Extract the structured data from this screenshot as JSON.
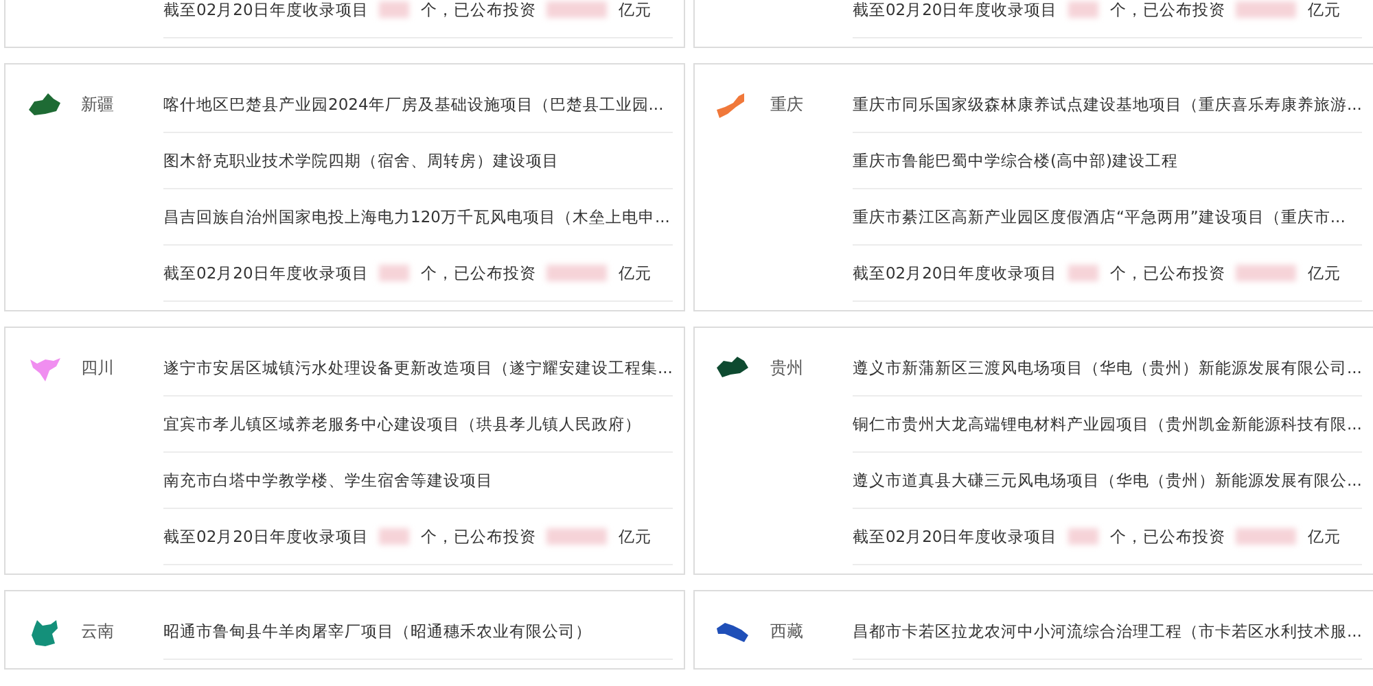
{
  "top_cards": [
    {
      "summary": {
        "prefix": "截至02月20日年度收录项目",
        "middle": "个，已公布投资",
        "suffix": "亿元"
      }
    },
    {
      "summary": {
        "prefix": "截至02月20日年度收录项目",
        "middle": "个，已公布投资",
        "suffix": "亿元"
      }
    }
  ],
  "regions": [
    {
      "name": "新疆",
      "color": "#1e6b34",
      "projects": [
        "喀什地区巴楚县产业园2024年厂房及基础设施项目（巴楚县工业园...",
        "图木舒克职业技术学院四期（宿舍、周转房）建设项目",
        "昌吉回族自治州国家电投上海电力120万千瓦风电项目（木垒上电申..."
      ],
      "summary": {
        "prefix": "截至02月20日年度收录项目",
        "middle": "个，已公布投资",
        "suffix": "亿元"
      }
    },
    {
      "name": "重庆",
      "color": "#f0783a",
      "projects": [
        "重庆市同乐国家级森林康养试点建设基地项目（重庆喜乐寿康养旅游...",
        "重庆市鲁能巴蜀中学综合楼(高中部)建设工程",
        "重庆市綦江区高新产业园区度假酒店“平急两用”建设项目（重庆市..."
      ],
      "summary": {
        "prefix": "截至02月20日年度收录项目",
        "middle": "个，已公布投资",
        "suffix": "亿元"
      }
    },
    {
      "name": "四川",
      "color": "#f08ef0",
      "projects": [
        "遂宁市安居区城镇污水处理设备更新改造项目（遂宁耀安建设工程集...",
        "宜宾市孝儿镇区域养老服务中心建设项目（珙县孝儿镇人民政府）",
        "南充市白塔中学教学楼、学生宿舍等建设项目"
      ],
      "summary": {
        "prefix": "截至02月20日年度收录项目",
        "middle": "个，已公布投资",
        "suffix": "亿元"
      }
    },
    {
      "name": "贵州",
      "color": "#0e4a30",
      "projects": [
        "遵义市新蒲新区三渡风电场项目（华电（贵州）新能源发展有限公司...",
        "铜仁市贵州大龙高端锂电材料产业园项目（贵州凯金新能源科技有限...",
        "遵义市道真县大磏三元风电场项目（华电（贵州）新能源发展有限公..."
      ],
      "summary": {
        "prefix": "截至02月20日年度收录项目",
        "middle": "个，已公布投资",
        "suffix": "亿元"
      }
    },
    {
      "name": "云南",
      "color": "#14907a",
      "projects": [
        "昭通市鲁甸县牛羊肉屠宰厂项目（昭通穗禾农业有限公司）"
      ]
    },
    {
      "name": "西藏",
      "color": "#1f4fb8",
      "projects": [
        "昌都市卡若区拉龙农河中小河流综合治理工程（市卡若区水利技术服..."
      ]
    }
  ]
}
